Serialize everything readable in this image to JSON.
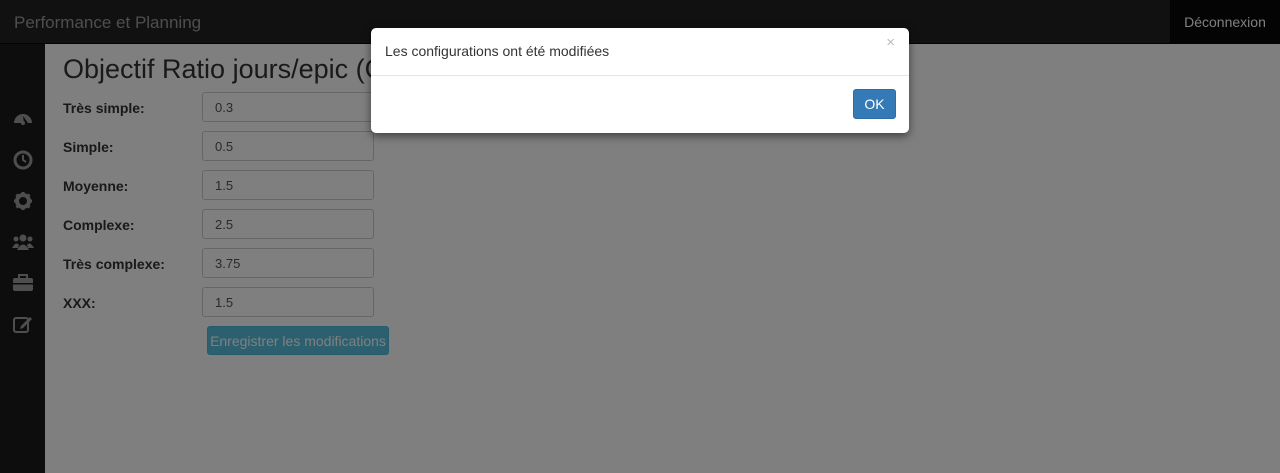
{
  "navbar": {
    "brand": "Performance et Planning",
    "logout_label": "Déconnexion"
  },
  "sidebar": {
    "icons": [
      "dashboard-icon",
      "clock-icon",
      "gear-icon",
      "users-icon",
      "briefcase-icon",
      "edit-icon"
    ]
  },
  "main": {
    "title": "Objectif Ratio jours/epic (C",
    "fields": [
      {
        "label": "Très simple:",
        "value": "0.3"
      },
      {
        "label": "Simple:",
        "value": "0.5"
      },
      {
        "label": "Moyenne:",
        "value": "1.5"
      },
      {
        "label": "Complexe:",
        "value": "2.5"
      },
      {
        "label": "Très complexe:",
        "value": "3.75"
      },
      {
        "label": "XXX:",
        "value": "1.5"
      }
    ],
    "save_label": "Enregistrer les modifications"
  },
  "modal": {
    "message": "Les configurations ont été modifiées",
    "close_symbol": "×",
    "ok_label": "OK"
  },
  "colors": {
    "navbar": "#222222",
    "primary": "#337ab7",
    "info": "#5bc0de"
  }
}
